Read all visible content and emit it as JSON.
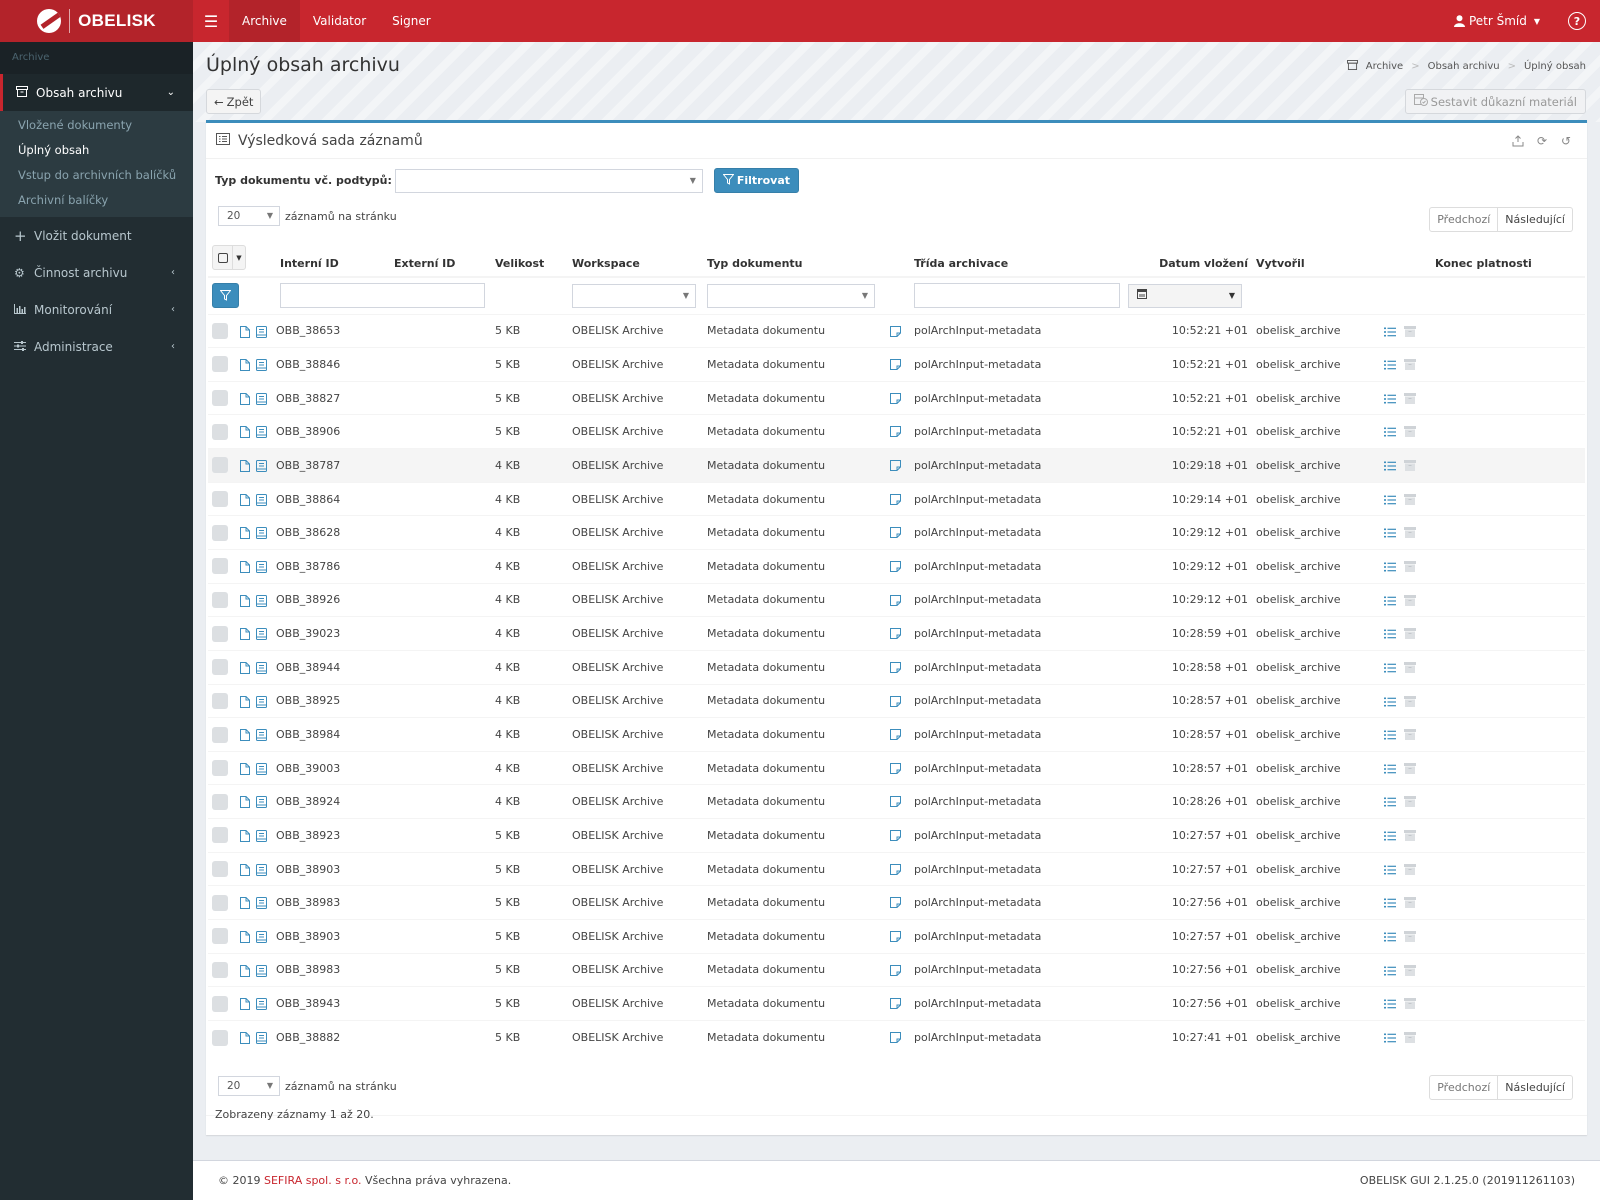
{
  "app": {
    "brand": "OBELISK",
    "nav": [
      {
        "label": "Archive",
        "active": true
      },
      {
        "label": "Validator",
        "active": false
      },
      {
        "label": "Signer",
        "active": false
      }
    ],
    "user": "Petr Šmíd",
    "help_icon": "question-circle-icon"
  },
  "sidebar": {
    "header": "Archive",
    "open_item": {
      "label": "Obsah archivu",
      "icon": "archive-box-icon"
    },
    "subitems": [
      {
        "label": "Vložené dokumenty",
        "active": false
      },
      {
        "label": "Úplný obsah",
        "active": true
      },
      {
        "label": "Vstup do archivních balíčků",
        "active": false
      },
      {
        "label": "Archivní balíčky",
        "active": false
      }
    ],
    "items": [
      {
        "label": "Vložit dokument",
        "icon": "plus-icon"
      },
      {
        "label": "Činnost archivu",
        "icon": "gear-icon"
      },
      {
        "label": "Monitorování",
        "icon": "bar-chart-icon"
      },
      {
        "label": "Administrace",
        "icon": "sliders-icon"
      }
    ]
  },
  "page": {
    "title": "Úplný obsah archivu",
    "breadcrumb": [
      "Archive",
      "Obsah archivu",
      "Úplný obsah"
    ],
    "back_label": "Zpět",
    "evidence_label": "Sestavit důkazní materiál"
  },
  "box": {
    "title": "Výsledková sada záznamů",
    "filter_label": "Typ dokumentu vč. podtypů:",
    "filter_value": "",
    "filter_button": "Filtrovat",
    "per_page_value": "20",
    "per_page_label": "záznamů na stránku",
    "prev_label": "Předchozí",
    "next_label": "Následující",
    "summary": "Zobrazeny záznamy 1 až 20."
  },
  "table": {
    "columns": [
      "Interní ID",
      "Externí ID",
      "Velikost",
      "Workspace",
      "Typ dokumentu",
      "Třída archivace",
      "Datum vložení",
      "Vytvořil",
      "Konec platnosti"
    ],
    "rows": [
      {
        "id": "OBB_38653",
        "ext": "",
        "size": "5 KB",
        "ws": "OBELISK Archive",
        "type": "Metadata dokumentu",
        "cls": "polArchInput-metadata",
        "date": "10:52:21 +01",
        "by": "obelisk_archive",
        "exp": ""
      },
      {
        "id": "OBB_38846",
        "ext": "",
        "size": "5 KB",
        "ws": "OBELISK Archive",
        "type": "Metadata dokumentu",
        "cls": "polArchInput-metadata",
        "date": "10:52:21 +01",
        "by": "obelisk_archive",
        "exp": ""
      },
      {
        "id": "OBB_38827",
        "ext": "",
        "size": "5 KB",
        "ws": "OBELISK Archive",
        "type": "Metadata dokumentu",
        "cls": "polArchInput-metadata",
        "date": "10:52:21 +01",
        "by": "obelisk_archive",
        "exp": ""
      },
      {
        "id": "OBB_38906",
        "ext": "",
        "size": "5 KB",
        "ws": "OBELISK Archive",
        "type": "Metadata dokumentu",
        "cls": "polArchInput-metadata",
        "date": "10:52:21 +01",
        "by": "obelisk_archive",
        "exp": ""
      },
      {
        "id": "OBB_38787",
        "ext": "",
        "size": "4 KB",
        "ws": "OBELISK Archive",
        "type": "Metadata dokumentu",
        "cls": "polArchInput-metadata",
        "date": "10:29:18 +01",
        "by": "obelisk_archive",
        "exp": ""
      },
      {
        "id": "OBB_38864",
        "ext": "",
        "size": "4 KB",
        "ws": "OBELISK Archive",
        "type": "Metadata dokumentu",
        "cls": "polArchInput-metadata",
        "date": "10:29:14 +01",
        "by": "obelisk_archive",
        "exp": ""
      },
      {
        "id": "OBB_38628",
        "ext": "",
        "size": "4 KB",
        "ws": "OBELISK Archive",
        "type": "Metadata dokumentu",
        "cls": "polArchInput-metadata",
        "date": "10:29:12 +01",
        "by": "obelisk_archive",
        "exp": ""
      },
      {
        "id": "OBB_38786",
        "ext": "",
        "size": "4 KB",
        "ws": "OBELISK Archive",
        "type": "Metadata dokumentu",
        "cls": "polArchInput-metadata",
        "date": "10:29:12 +01",
        "by": "obelisk_archive",
        "exp": ""
      },
      {
        "id": "OBB_38926",
        "ext": "",
        "size": "4 KB",
        "ws": "OBELISK Archive",
        "type": "Metadata dokumentu",
        "cls": "polArchInput-metadata",
        "date": "10:29:12 +01",
        "by": "obelisk_archive",
        "exp": ""
      },
      {
        "id": "OBB_39023",
        "ext": "",
        "size": "4 KB",
        "ws": "OBELISK Archive",
        "type": "Metadata dokumentu",
        "cls": "polArchInput-metadata",
        "date": "10:28:59 +01",
        "by": "obelisk_archive",
        "exp": ""
      },
      {
        "id": "OBB_38944",
        "ext": "",
        "size": "4 KB",
        "ws": "OBELISK Archive",
        "type": "Metadata dokumentu",
        "cls": "polArchInput-metadata",
        "date": "10:28:58 +01",
        "by": "obelisk_archive",
        "exp": ""
      },
      {
        "id": "OBB_38925",
        "ext": "",
        "size": "4 KB",
        "ws": "OBELISK Archive",
        "type": "Metadata dokumentu",
        "cls": "polArchInput-metadata",
        "date": "10:28:57 +01",
        "by": "obelisk_archive",
        "exp": ""
      },
      {
        "id": "OBB_38984",
        "ext": "",
        "size": "4 KB",
        "ws": "OBELISK Archive",
        "type": "Metadata dokumentu",
        "cls": "polArchInput-metadata",
        "date": "10:28:57 +01",
        "by": "obelisk_archive",
        "exp": ""
      },
      {
        "id": "OBB_39003",
        "ext": "",
        "size": "4 KB",
        "ws": "OBELISK Archive",
        "type": "Metadata dokumentu",
        "cls": "polArchInput-metadata",
        "date": "10:28:57 +01",
        "by": "obelisk_archive",
        "exp": ""
      },
      {
        "id": "OBB_38924",
        "ext": "",
        "size": "4 KB",
        "ws": "OBELISK Archive",
        "type": "Metadata dokumentu",
        "cls": "polArchInput-metadata",
        "date": "10:28:26 +01",
        "by": "obelisk_archive",
        "exp": ""
      },
      {
        "id": "OBB_38923",
        "ext": "",
        "size": "5 KB",
        "ws": "OBELISK Archive",
        "type": "Metadata dokumentu",
        "cls": "polArchInput-metadata",
        "date": "10:27:57 +01",
        "by": "obelisk_archive",
        "exp": ""
      },
      {
        "id": "OBB_38903",
        "ext": "",
        "size": "5 KB",
        "ws": "OBELISK Archive",
        "type": "Metadata dokumentu",
        "cls": "polArchInput-metadata",
        "date": "10:27:57 +01",
        "by": "obelisk_archive",
        "exp": ""
      },
      {
        "id": "OBB_38983",
        "ext": "",
        "size": "5 KB",
        "ws": "OBELISK Archive",
        "type": "Metadata dokumentu",
        "cls": "polArchInput-metadata",
        "date": "10:27:56 +01",
        "by": "obelisk_archive",
        "exp": ""
      },
      {
        "id": "OBB_38903",
        "ext": "",
        "size": "5 KB",
        "ws": "OBELISK Archive",
        "type": "Metadata dokumentu",
        "cls": "polArchInput-metadata",
        "date": "10:27:57 +01",
        "by": "obelisk_archive",
        "exp": ""
      },
      {
        "id": "OBB_38983",
        "ext": "",
        "size": "5 KB",
        "ws": "OBELISK Archive",
        "type": "Metadata dokumentu",
        "cls": "polArchInput-metadata",
        "date": "10:27:56 +01",
        "by": "obelisk_archive",
        "exp": ""
      },
      {
        "id": "OBB_38943",
        "ext": "",
        "size": "5 KB",
        "ws": "OBELISK Archive",
        "type": "Metadata dokumentu",
        "cls": "polArchInput-metadata",
        "date": "10:27:56 +01",
        "by": "obelisk_archive",
        "exp": ""
      },
      {
        "id": "OBB_38882",
        "ext": "",
        "size": "5 KB",
        "ws": "OBELISK Archive",
        "type": "Metadata dokumentu",
        "cls": "polArchInput-metadata",
        "date": "10:27:41 +01",
        "by": "obelisk_archive",
        "exp": ""
      }
    ]
  },
  "footer": {
    "copyright_prefix": "© 2019",
    "company": "SEFIRA spol. s r.o.",
    "rights": "Všechna práva vyhrazena.",
    "version": "OBELISK GUI 2.1.25.0 (201911261103)"
  },
  "colors": {
    "brand_red": "#c8262e",
    "accent_blue": "#3c8dbc",
    "sidebar_bg": "#222d32"
  }
}
